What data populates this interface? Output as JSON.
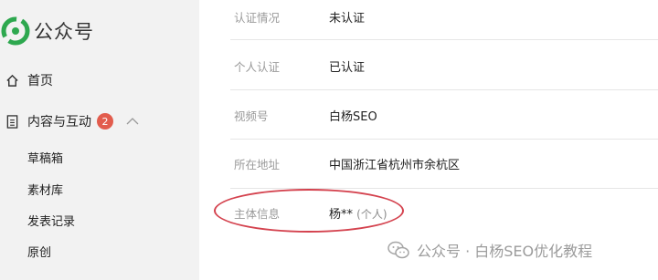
{
  "app": {
    "title": "公众号"
  },
  "sidebar": {
    "home": {
      "label": "首页",
      "icon": "home-icon"
    },
    "content": {
      "label": "内容与互动",
      "icon": "document-icon",
      "badge": "2",
      "expanded": true
    },
    "sub_items": [
      {
        "label": "草稿箱"
      },
      {
        "label": "素材库"
      },
      {
        "label": "发表记录"
      },
      {
        "label": "原创"
      }
    ]
  },
  "info": {
    "rows": [
      {
        "label": "认证情况",
        "value": "未认证"
      },
      {
        "label": "个人认证",
        "value": "已认证"
      },
      {
        "label": "视频号",
        "value": "白杨SEO"
      },
      {
        "label": "所在地址",
        "value": "中国浙江省杭州市余杭区"
      },
      {
        "label": "主体信息",
        "value": "杨**",
        "value_note": "(个人)"
      }
    ]
  },
  "watermark": {
    "text": "公众号 · 白杨SEO优化教程"
  },
  "colors": {
    "sidebar_bg": "#f2f2f2",
    "badge": "#e25c4d",
    "highlight_ellipse": "#d4424e",
    "logo_green": "#2ea84f"
  }
}
